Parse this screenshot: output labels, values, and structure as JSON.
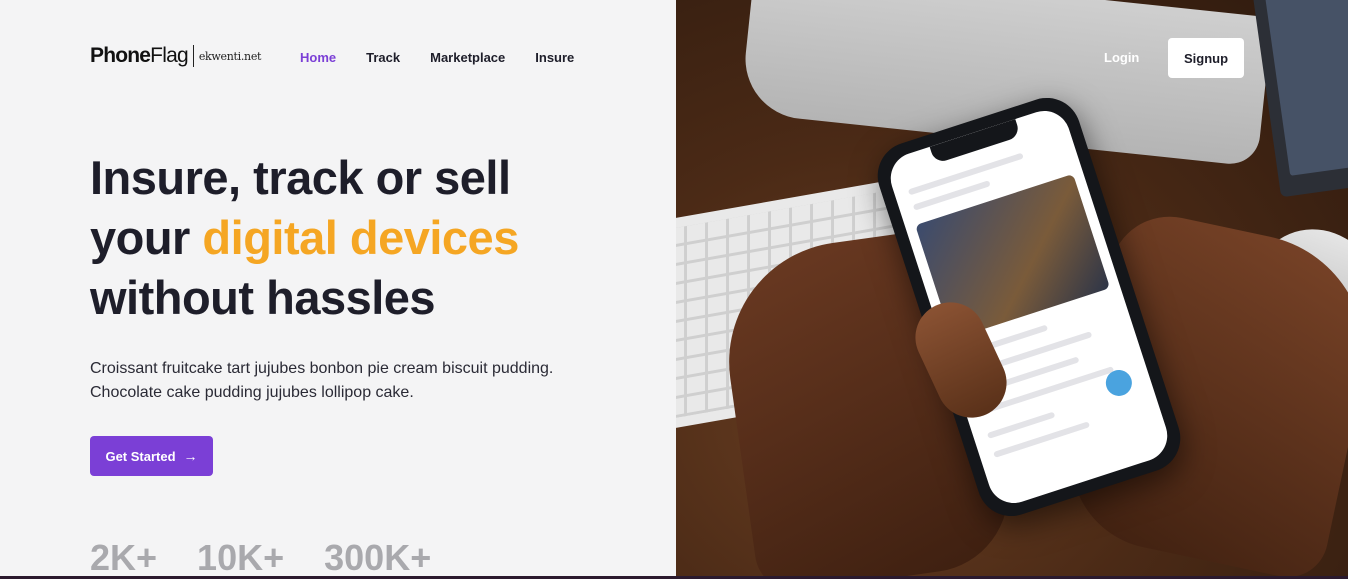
{
  "header": {
    "logo_main_bold": "Phone",
    "logo_main_light": "Flag",
    "logo_sub": "ekwenti.net",
    "nav": [
      {
        "label": "Home",
        "active": true
      },
      {
        "label": "Track",
        "active": false
      },
      {
        "label": "Marketplace",
        "active": false
      },
      {
        "label": "Insure",
        "active": false
      }
    ],
    "login_label": "Login",
    "signup_label": "Signup"
  },
  "hero": {
    "title_line1": "Insure, track or sell",
    "title_line2_prefix": "your ",
    "title_line2_accent": "digital devices",
    "title_line3": "without hassles",
    "description_line1": "Croissant fruitcake tart jujubes bonbon pie cream biscuit pudding.",
    "description_line2": "Chocolate cake pudding jujubes lollipop cake.",
    "cta_label": "Get Started",
    "cta_icon": "arrow-right-icon"
  },
  "stats": [
    "2K+",
    "10K+",
    "300K+"
  ],
  "colors": {
    "accent_purple": "#7b3fd6",
    "accent_orange": "#f5a623",
    "text_dark": "#1e1e2a",
    "stat_gray": "#a9a9ad",
    "left_background": "#f4f4f5"
  }
}
